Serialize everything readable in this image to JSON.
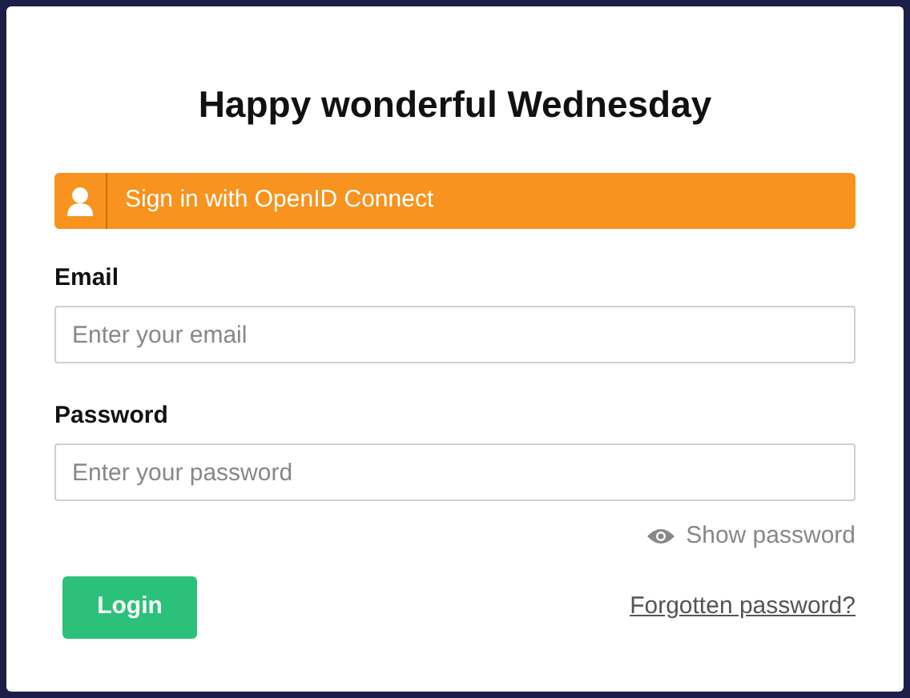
{
  "title": "Happy wonderful Wednesday",
  "sso_button": {
    "label": "Sign in with OpenID Connect"
  },
  "fields": [
    {
      "label": "Email",
      "placeholder": "Enter your email"
    },
    {
      "label": "Password",
      "placeholder": "Enter your password"
    }
  ],
  "show_password": {
    "label": "Show password"
  },
  "login_button": {
    "label": "Login"
  },
  "forgot_link": {
    "label": "Forgotten password?"
  }
}
